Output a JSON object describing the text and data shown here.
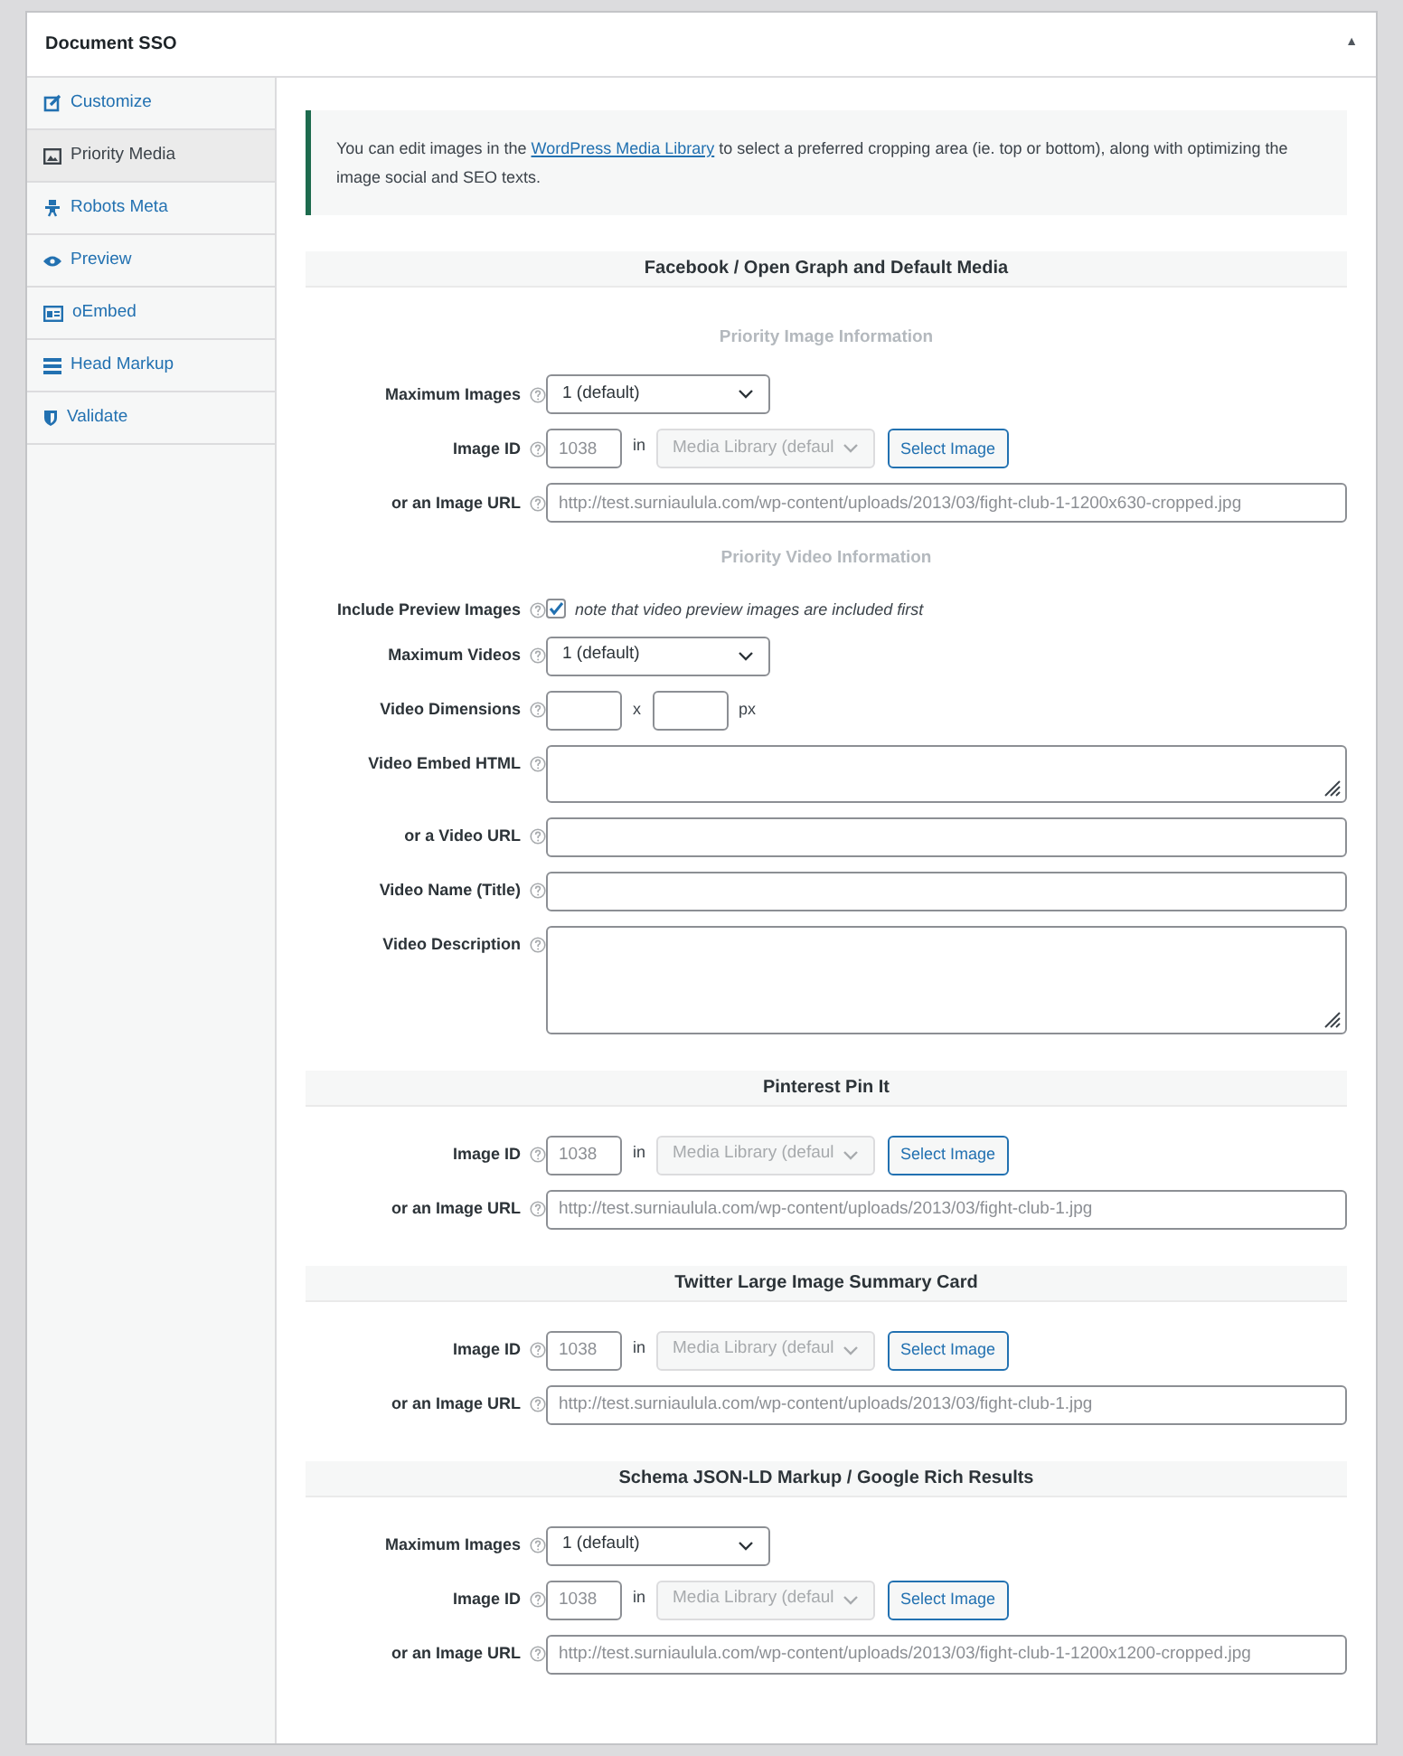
{
  "panel": {
    "title": "Document SSO",
    "toggle": "▲"
  },
  "tabs": [
    {
      "label": "Customize",
      "selected": false
    },
    {
      "label": "Priority Media",
      "selected": true
    },
    {
      "label": "Robots Meta",
      "selected": false
    },
    {
      "label": "Preview",
      "selected": false
    },
    {
      "label": "oEmbed",
      "selected": false
    },
    {
      "label": "Head Markup",
      "selected": false
    },
    {
      "label": "Validate",
      "selected": false
    }
  ],
  "notice": {
    "before": "You can edit images in the ",
    "link": "WordPress Media Library",
    "after": " to select a preferred cropping area (ie. top or bottom), along with optimizing the image social and SEO texts."
  },
  "sections": [
    {
      "title": "Facebook / Open Graph and Default Media",
      "rows": [
        {
          "kind": "subheading",
          "text": "Priority Image Information"
        },
        {
          "kind": "select",
          "label": "Maximum Images",
          "value": "1 (default)"
        },
        {
          "kind": "imageid",
          "label": "Image ID",
          "placeholder": "1038",
          "in": "in",
          "library": "Media Library (defaul",
          "button": "Select Image"
        },
        {
          "kind": "url",
          "label": "or an Image URL",
          "placeholder": "http://test.surniaulula.com/wp-content/uploads/2013/03/fight-club-1-1200x630-cropped.jpg"
        },
        {
          "kind": "subheading",
          "text": "Priority Video Information"
        },
        {
          "kind": "checkbox",
          "label": "Include Preview Images",
          "checked": true,
          "note": "note that video preview images are included first"
        },
        {
          "kind": "select",
          "label": "Maximum Videos",
          "value": "1 (default)"
        },
        {
          "kind": "dimensions",
          "label": "Video Dimensions",
          "separator": "x",
          "unit": "px"
        },
        {
          "kind": "code",
          "label": "Video Embed HTML"
        },
        {
          "kind": "url",
          "label": "or a Video URL"
        },
        {
          "kind": "url",
          "label": "Video Name (Title)"
        },
        {
          "kind": "textarea",
          "label": "Video Description"
        }
      ]
    },
    {
      "title": "Pinterest Pin It",
      "rows": [
        {
          "kind": "imageid",
          "label": "Image ID",
          "placeholder": "1038",
          "in": "in",
          "library": "Media Library (defaul",
          "button": "Select Image"
        },
        {
          "kind": "url",
          "label": "or an Image URL",
          "placeholder": "http://test.surniaulula.com/wp-content/uploads/2013/03/fight-club-1.jpg"
        }
      ]
    },
    {
      "title": "Twitter Large Image Summary Card",
      "rows": [
        {
          "kind": "imageid",
          "label": "Image ID",
          "placeholder": "1038",
          "in": "in",
          "library": "Media Library (defaul",
          "button": "Select Image"
        },
        {
          "kind": "url",
          "label": "or an Image URL",
          "placeholder": "http://test.surniaulula.com/wp-content/uploads/2013/03/fight-club-1.jpg"
        }
      ]
    },
    {
      "title": "Schema JSON-LD Markup / Google Rich Results",
      "rows": [
        {
          "kind": "select",
          "label": "Maximum Images",
          "value": "1 (default)"
        },
        {
          "kind": "imageid",
          "label": "Image ID",
          "placeholder": "1038",
          "in": "in",
          "library": "Media Library (defaul",
          "button": "Select Image"
        },
        {
          "kind": "url",
          "label": "or an Image URL",
          "placeholder": "http://test.surniaulula.com/wp-content/uploads/2013/03/fight-club-1-1200x1200-cropped.jpg"
        }
      ]
    }
  ]
}
